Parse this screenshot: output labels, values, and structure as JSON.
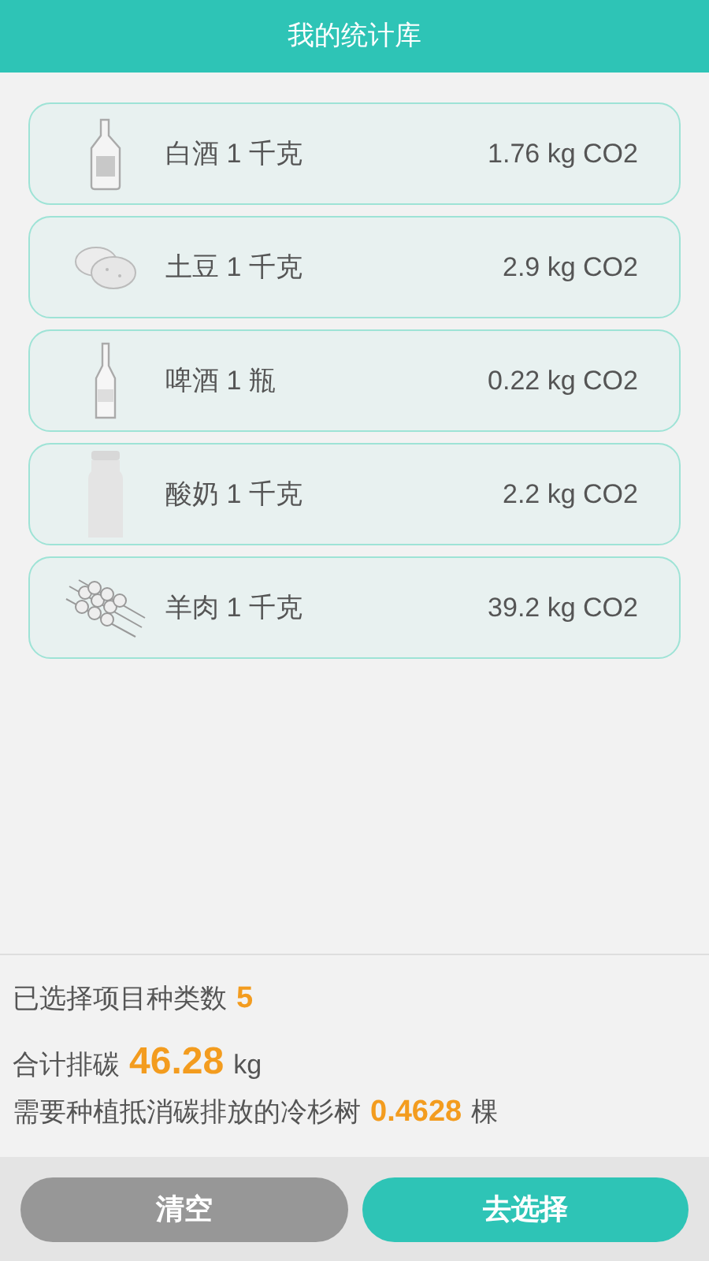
{
  "header": {
    "title": "我的统计库"
  },
  "items": [
    {
      "kind": "liquor",
      "label": "白酒 1 千克",
      "emission": "1.76 kg CO2"
    },
    {
      "kind": "potato",
      "label": "土豆 1 千克",
      "emission": "2.9 kg CO2"
    },
    {
      "kind": "beer",
      "label": "啤酒 1 瓶",
      "emission": "0.22 kg CO2"
    },
    {
      "kind": "yogurt",
      "label": "酸奶 1 千克",
      "emission": "2.2 kg CO2"
    },
    {
      "kind": "skewer",
      "label": "羊肉 1 千克",
      "emission": "39.2 kg CO2"
    }
  ],
  "summary": [
    {
      "label": "已选择项目种类数",
      "value": "5"
    },
    {
      "label": "合计排碳",
      "value": "46.28",
      "unit": "kg"
    },
    {
      "label": "需要种植抵消碳排放的冷杉树",
      "value": "0.4628",
      "unit": "棵"
    }
  ],
  "buttons": [
    {
      "kind": "clear",
      "label": "清空"
    },
    {
      "kind": "choose",
      "label": "去选择"
    }
  ]
}
